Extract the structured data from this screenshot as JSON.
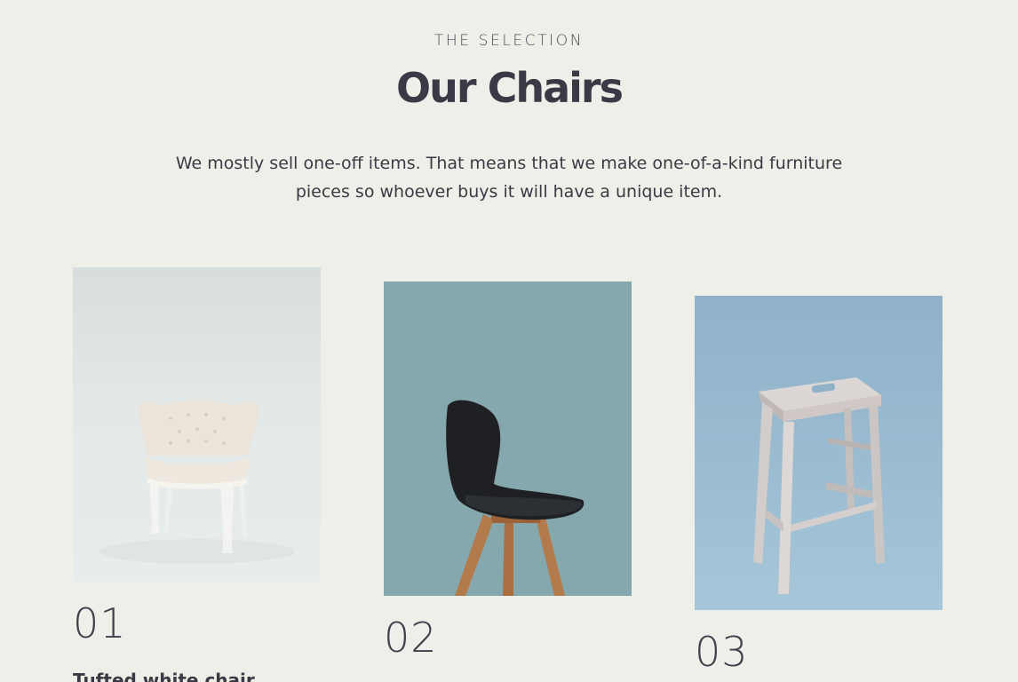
{
  "section": {
    "eyebrow": "THE SELECTION",
    "title": "Our Chairs",
    "lead": "We mostly sell one-off items. That means that we make one-of-a-kind furniture pieces so whoever buys it will have a unique item."
  },
  "products": [
    {
      "number": "01",
      "image_icon": "white-tufted-armchair-photo",
      "name": "Tufted white chair"
    },
    {
      "number": "02",
      "image_icon": "black-shell-chair-photo",
      "name": ""
    },
    {
      "number": "03",
      "image_icon": "wooden-bar-stool-photo",
      "name": ""
    }
  ],
  "colors": {
    "background": "#efefea",
    "text": "#3a3a44",
    "photo_1_bg": "#e3e8e8",
    "photo_2_bg": "#84a8ad",
    "photo_3_bg": "#9cbdd2"
  }
}
